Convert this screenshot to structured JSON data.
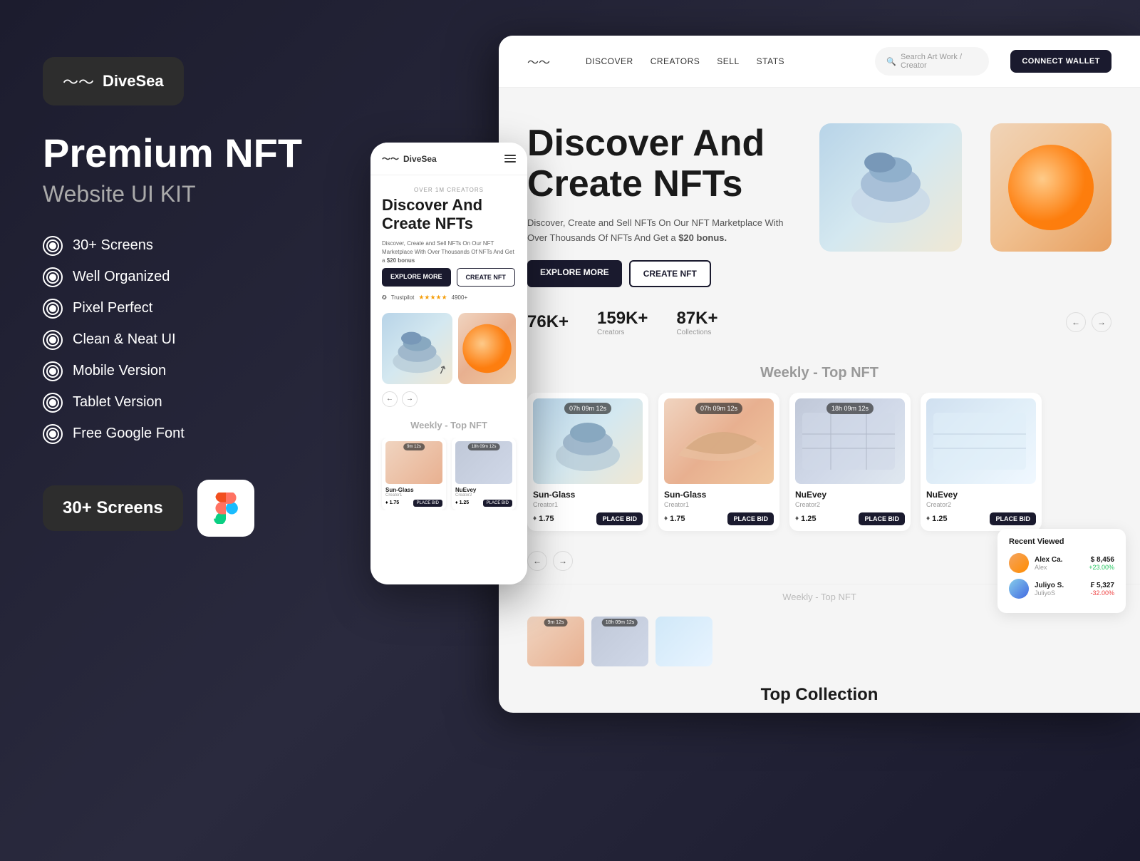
{
  "brand": {
    "name": "DiveSea",
    "tagline": "Premium NFT",
    "subtitle": "Website UI KIT"
  },
  "features": [
    "30+ Screens",
    "Well Organized",
    "Pixel Perfect",
    "Clean & Neat UI",
    "Mobile Version",
    "Tablet Version",
    "Free Google Font"
  ],
  "bottom_badge": {
    "screens": "30+ Screens",
    "figma": "Figma"
  },
  "navbar": {
    "logo": "DiveSea",
    "links": [
      "DISCOVER",
      "CREATORS",
      "SELL",
      "STATS"
    ],
    "search_placeholder": "Search Art Work / Creator",
    "connect_wallet": "CONNECT WALLET"
  },
  "hero": {
    "title": "Discover And Create NFTs",
    "description": "Discover, Create and Sell NFTs On Our NFT Marketplace With Over Thousands Of NFTs And Get a",
    "bonus": "$20 bonus.",
    "explore_btn": "EXPLORE MORE",
    "create_btn": "CREATE NFT",
    "stats": [
      {
        "value": "76K+",
        "label": ""
      },
      {
        "value": "159K+",
        "label": "Creators"
      },
      {
        "value": "87K+",
        "label": "Collections"
      }
    ]
  },
  "weekly_nft": {
    "section_title": "Weekly - Top NFT",
    "cards": [
      {
        "name": "Sun-Glass",
        "creator": "Creator1",
        "price": "1.75",
        "timer": "07h 09m 12s"
      },
      {
        "name": "Sun-Glass",
        "creator": "Creator1",
        "price": "1.75",
        "timer": "07h 09m 12s"
      },
      {
        "name": "NuEvey",
        "creator": "Creator2",
        "price": "1.25",
        "timer": "18h 09m 12s"
      },
      {
        "name": "NuEvey",
        "creator": "Creator2",
        "price": "1.25",
        "timer": ""
      }
    ],
    "place_bid_label": "PLACE BID"
  },
  "recent_viewed": {
    "title": "Recent Viewed",
    "items": [
      {
        "name": "Alex Ca.",
        "sub": "Alex",
        "value": "$ 8,456",
        "change": "+23.00%",
        "positive": true
      },
      {
        "name": "Juliyo S.",
        "sub": "JuliyoS",
        "value": "₣ 5,327",
        "change": "-32.00%",
        "positive": false
      }
    ]
  },
  "top_collection": {
    "title": "Top Collection"
  },
  "mobile": {
    "over_text": "OVER 1M CREATORS",
    "hero_title": "Discover And Create NFTs",
    "description": "Discover, Create and Sell NFTs On Our NFT Marketplace With Over Thousands Of NFTs And Get a",
    "bonus": "$20 bonus",
    "explore_btn": "EXPLORE MORE",
    "create_btn": "CREATE NFT",
    "trustpilot": "Trustpilot",
    "rating": "4900+",
    "section_title": "Weekly - Top NFT"
  }
}
